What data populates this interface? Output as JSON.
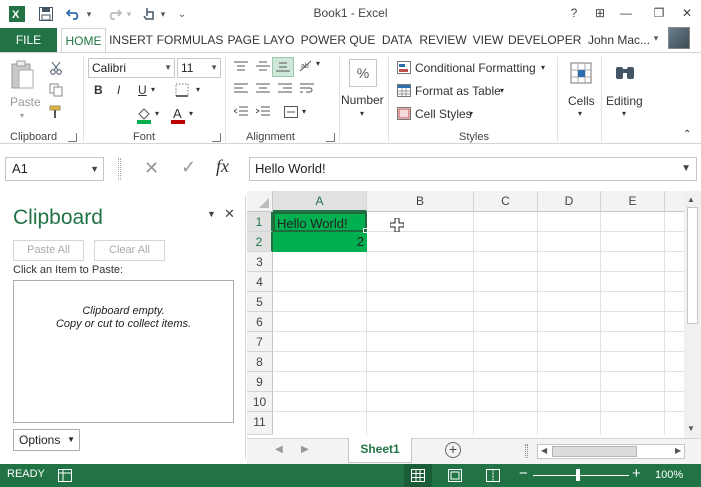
{
  "window": {
    "title": "Book1 - Excel",
    "help": "?",
    "ribbon_options": "⊞",
    "minimize": "—",
    "restore": "❐",
    "close": "✕"
  },
  "qat": {
    "save_icon": "save-icon",
    "undo_icon": "undo-icon",
    "redo_icon": "redo-icon",
    "touch_icon": "touch-mode-icon",
    "customize": "⌄"
  },
  "tabs": [
    {
      "label": "FILE"
    },
    {
      "label": "HOME"
    },
    {
      "label": "INSERT"
    },
    {
      "label": "FORMULAS"
    },
    {
      "label": "PAGE LAYO"
    },
    {
      "label": "POWER QUE"
    },
    {
      "label": "DATA"
    },
    {
      "label": "REVIEW"
    },
    {
      "label": "VIEW"
    },
    {
      "label": "DEVELOPER"
    }
  ],
  "user": {
    "name": "John Mac..."
  },
  "ribbon": {
    "clipboard": {
      "label": "Clipboard",
      "paste_label": "Paste"
    },
    "font": {
      "label": "Font",
      "name": "Calibri",
      "size": "11",
      "bold": "B",
      "italic": "I",
      "underline": "U",
      "fill_color": "#00b050",
      "font_color": "#c00000"
    },
    "alignment": {
      "label": "Alignment"
    },
    "number": {
      "label": "Number",
      "percent": "%"
    },
    "styles": {
      "label": "Styles",
      "conditional_formatting": "Conditional Formatting",
      "format_as_table": "Format as Table",
      "cell_styles": "Cell Styles"
    },
    "cells": {
      "label": "Cells"
    },
    "editing": {
      "label": "Editing"
    }
  },
  "formula_bar": {
    "name_box": "A1",
    "cancel": "✕",
    "enter": "✓",
    "fx": "fx",
    "value": "Hello World!"
  },
  "clipboard_pane": {
    "title": "Clipboard",
    "paste_all": "Paste All",
    "clear_all": "Clear All",
    "instruction": "Click an Item to Paste:",
    "empty_line1": "Clipboard empty.",
    "empty_line2": "Copy or cut to collect items.",
    "options": "Options"
  },
  "grid": {
    "columns": [
      "A",
      "B",
      "C",
      "D",
      "E"
    ],
    "rows": [
      "1",
      "2",
      "3",
      "4",
      "5",
      "6",
      "7",
      "8",
      "9",
      "10",
      "11"
    ],
    "cells": {
      "A1": "Hello World!",
      "A2": "2"
    },
    "selected_fill": "#00b050"
  },
  "sheets": {
    "active": "Sheet1",
    "add": "+"
  },
  "status": {
    "text": "READY",
    "zoom": "100%"
  },
  "colors": {
    "accent": "#217346"
  }
}
